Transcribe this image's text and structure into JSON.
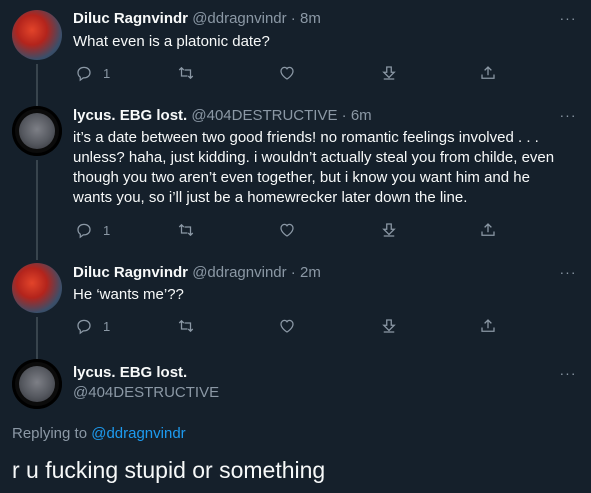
{
  "tweets": [
    {
      "name": "Diluc Ragnvindr",
      "handle": "@ddragnvindr",
      "separator": " · ",
      "time": "8m",
      "text": "What even is a platonic date?",
      "reply_count": "1"
    },
    {
      "name": "lycus. EBG lost.",
      "handle": "@404DESTRUCTIVE",
      "separator": " · ",
      "time": "6m",
      "text": "it’s a date between two good friends! no romantic feelings involved . . . unless? haha, just kidding. i wouldn’t actually steal you from childe, even though you two aren’t even together, but i know you want him and he wants you, so i’ll just be a homewrecker later down the line.",
      "reply_count": "1"
    },
    {
      "name": "Diluc Ragnvindr",
      "handle": "@ddragnvindr",
      "separator": " · ",
      "time": "2m",
      "text": "He ‘wants me’??",
      "reply_count": "1"
    }
  ],
  "main_tweet": {
    "name": "lycus. EBG lost.",
    "handle": "@404DESTRUCTIVE",
    "replying_to_label": "Replying to ",
    "replying_to_handle": "@ddragnvindr",
    "text": "r u fucking stupid or something"
  },
  "more_glyph": "···",
  "icons": [
    "reply-icon",
    "retweet-icon",
    "like-icon",
    "bookmark-icon",
    "share-icon",
    "more-icon"
  ]
}
